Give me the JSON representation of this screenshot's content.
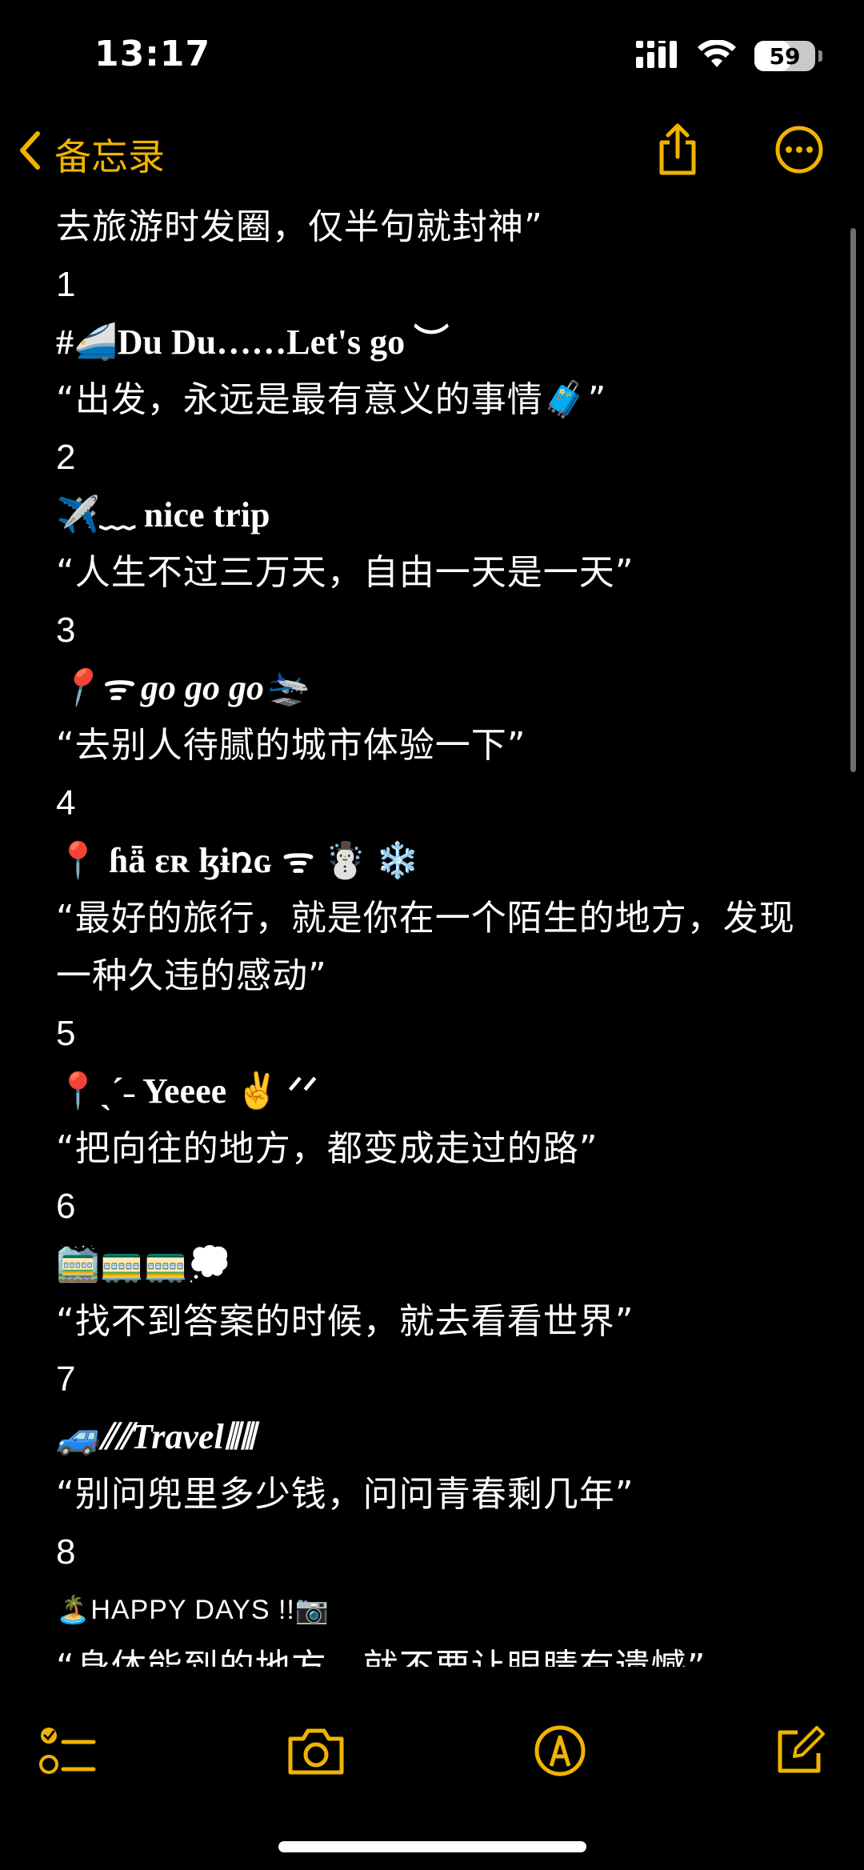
{
  "status_bar": {
    "time": "13:17",
    "battery": "59",
    "battery_level": 0.59
  },
  "nav": {
    "back_label": "备忘录"
  },
  "note": {
    "lines": [
      {
        "text": "去旅游时发圈，仅半句就封神”",
        "style": "quote"
      },
      {
        "text": "1",
        "style": "num"
      },
      {
        "text": "#🚄Du  Du……Let's go ︶",
        "style": "deco"
      },
      {
        "text": "“出发，永远是最有意义的事情🧳”",
        "style": "quote"
      },
      {
        "text": "2",
        "style": "num"
      },
      {
        "text": "✈️﹏ nice trip",
        "style": "deco"
      },
      {
        "text": "“人生不过三万天，自由一天是一天”",
        "style": "quote"
      },
      {
        "text": "3",
        "style": "num"
      },
      {
        "text": "📍ᯤ go go go🛬",
        "style": "deco italic"
      },
      {
        "text": "“去别人待腻的城市体验一下”",
        "style": "quote"
      },
      {
        "text": "4",
        "style": "num"
      },
      {
        "text": "📍 ɦǟ ɛʀ ɮɨռɢ ᯤ ☃️ ❄️",
        "style": "deco"
      },
      {
        "text": "“最好的旅行，就是你在一个陌生的地方，发现一种久违的感动”",
        "style": "quote wrap"
      },
      {
        "text": "5",
        "style": "num"
      },
      {
        "text": "📍ˎˊ˗ Yeeee ✌️ ᐟᐟ",
        "style": "deco"
      },
      {
        "text": "“把向往的地方，都变成走过的路”",
        "style": "quote"
      },
      {
        "text": "6",
        "style": "num"
      },
      {
        "text": "🚞🚃🚃💭",
        "style": "deco"
      },
      {
        "text": "“找不到答案的时候，就去看看世界”",
        "style": "quote"
      },
      {
        "text": "7",
        "style": "num"
      },
      {
        "text": "🚙⫽⫽Travel⦀⦀",
        "style": "deco italic"
      },
      {
        "text": "“别问兜里多少钱，问问青春剩几年”",
        "style": "quote"
      },
      {
        "text": "8",
        "style": "num"
      },
      {
        "text": "🏝️HAPPY DAYS !!📷",
        "style": "deco caps"
      },
      {
        "text": "“身体能到的地方，就不要让眼睛有遗憾”",
        "style": "quote"
      }
    ]
  },
  "theme": {
    "accent": "#f0b400",
    "background": "#000000",
    "text": "#ffffff"
  },
  "icons": {
    "back": "chevron-left-icon",
    "share": "share-icon",
    "more": "ellipsis-circle-icon",
    "checklist": "checklist-icon",
    "camera": "camera-icon",
    "markup": "markup-pen-icon",
    "compose": "compose-icon"
  }
}
